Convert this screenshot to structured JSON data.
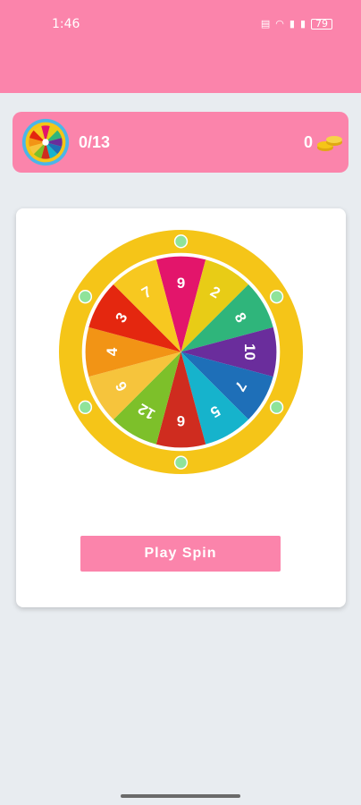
{
  "status": {
    "time": "1:46",
    "battery": "79"
  },
  "header": {
    "progress": "0/13",
    "coins": "0"
  },
  "wheel": {
    "segments": [
      {
        "label": "9",
        "color": "#e3156b"
      },
      {
        "label": "2",
        "color": "#e8cc16"
      },
      {
        "label": "8",
        "color": "#2fb57b"
      },
      {
        "label": "10",
        "color": "#6a2d9c"
      },
      {
        "label": "7",
        "color": "#1e6fb8"
      },
      {
        "label": "5",
        "color": "#16b3cc"
      },
      {
        "label": "6",
        "color": "#cf2c1f"
      },
      {
        "label": "12",
        "color": "#7dc02a"
      },
      {
        "label": "6",
        "color": "#f6c43c"
      },
      {
        "label": "4",
        "color": "#f29415"
      },
      {
        "label": "3",
        "color": "#e4270f"
      },
      {
        "label": "7",
        "color": "#f7c820"
      }
    ],
    "rim_color": "#f5c518"
  },
  "actions": {
    "play_label": "Play Spin"
  },
  "colors": {
    "accent": "#fb84ab",
    "background": "#e8ecf0"
  }
}
